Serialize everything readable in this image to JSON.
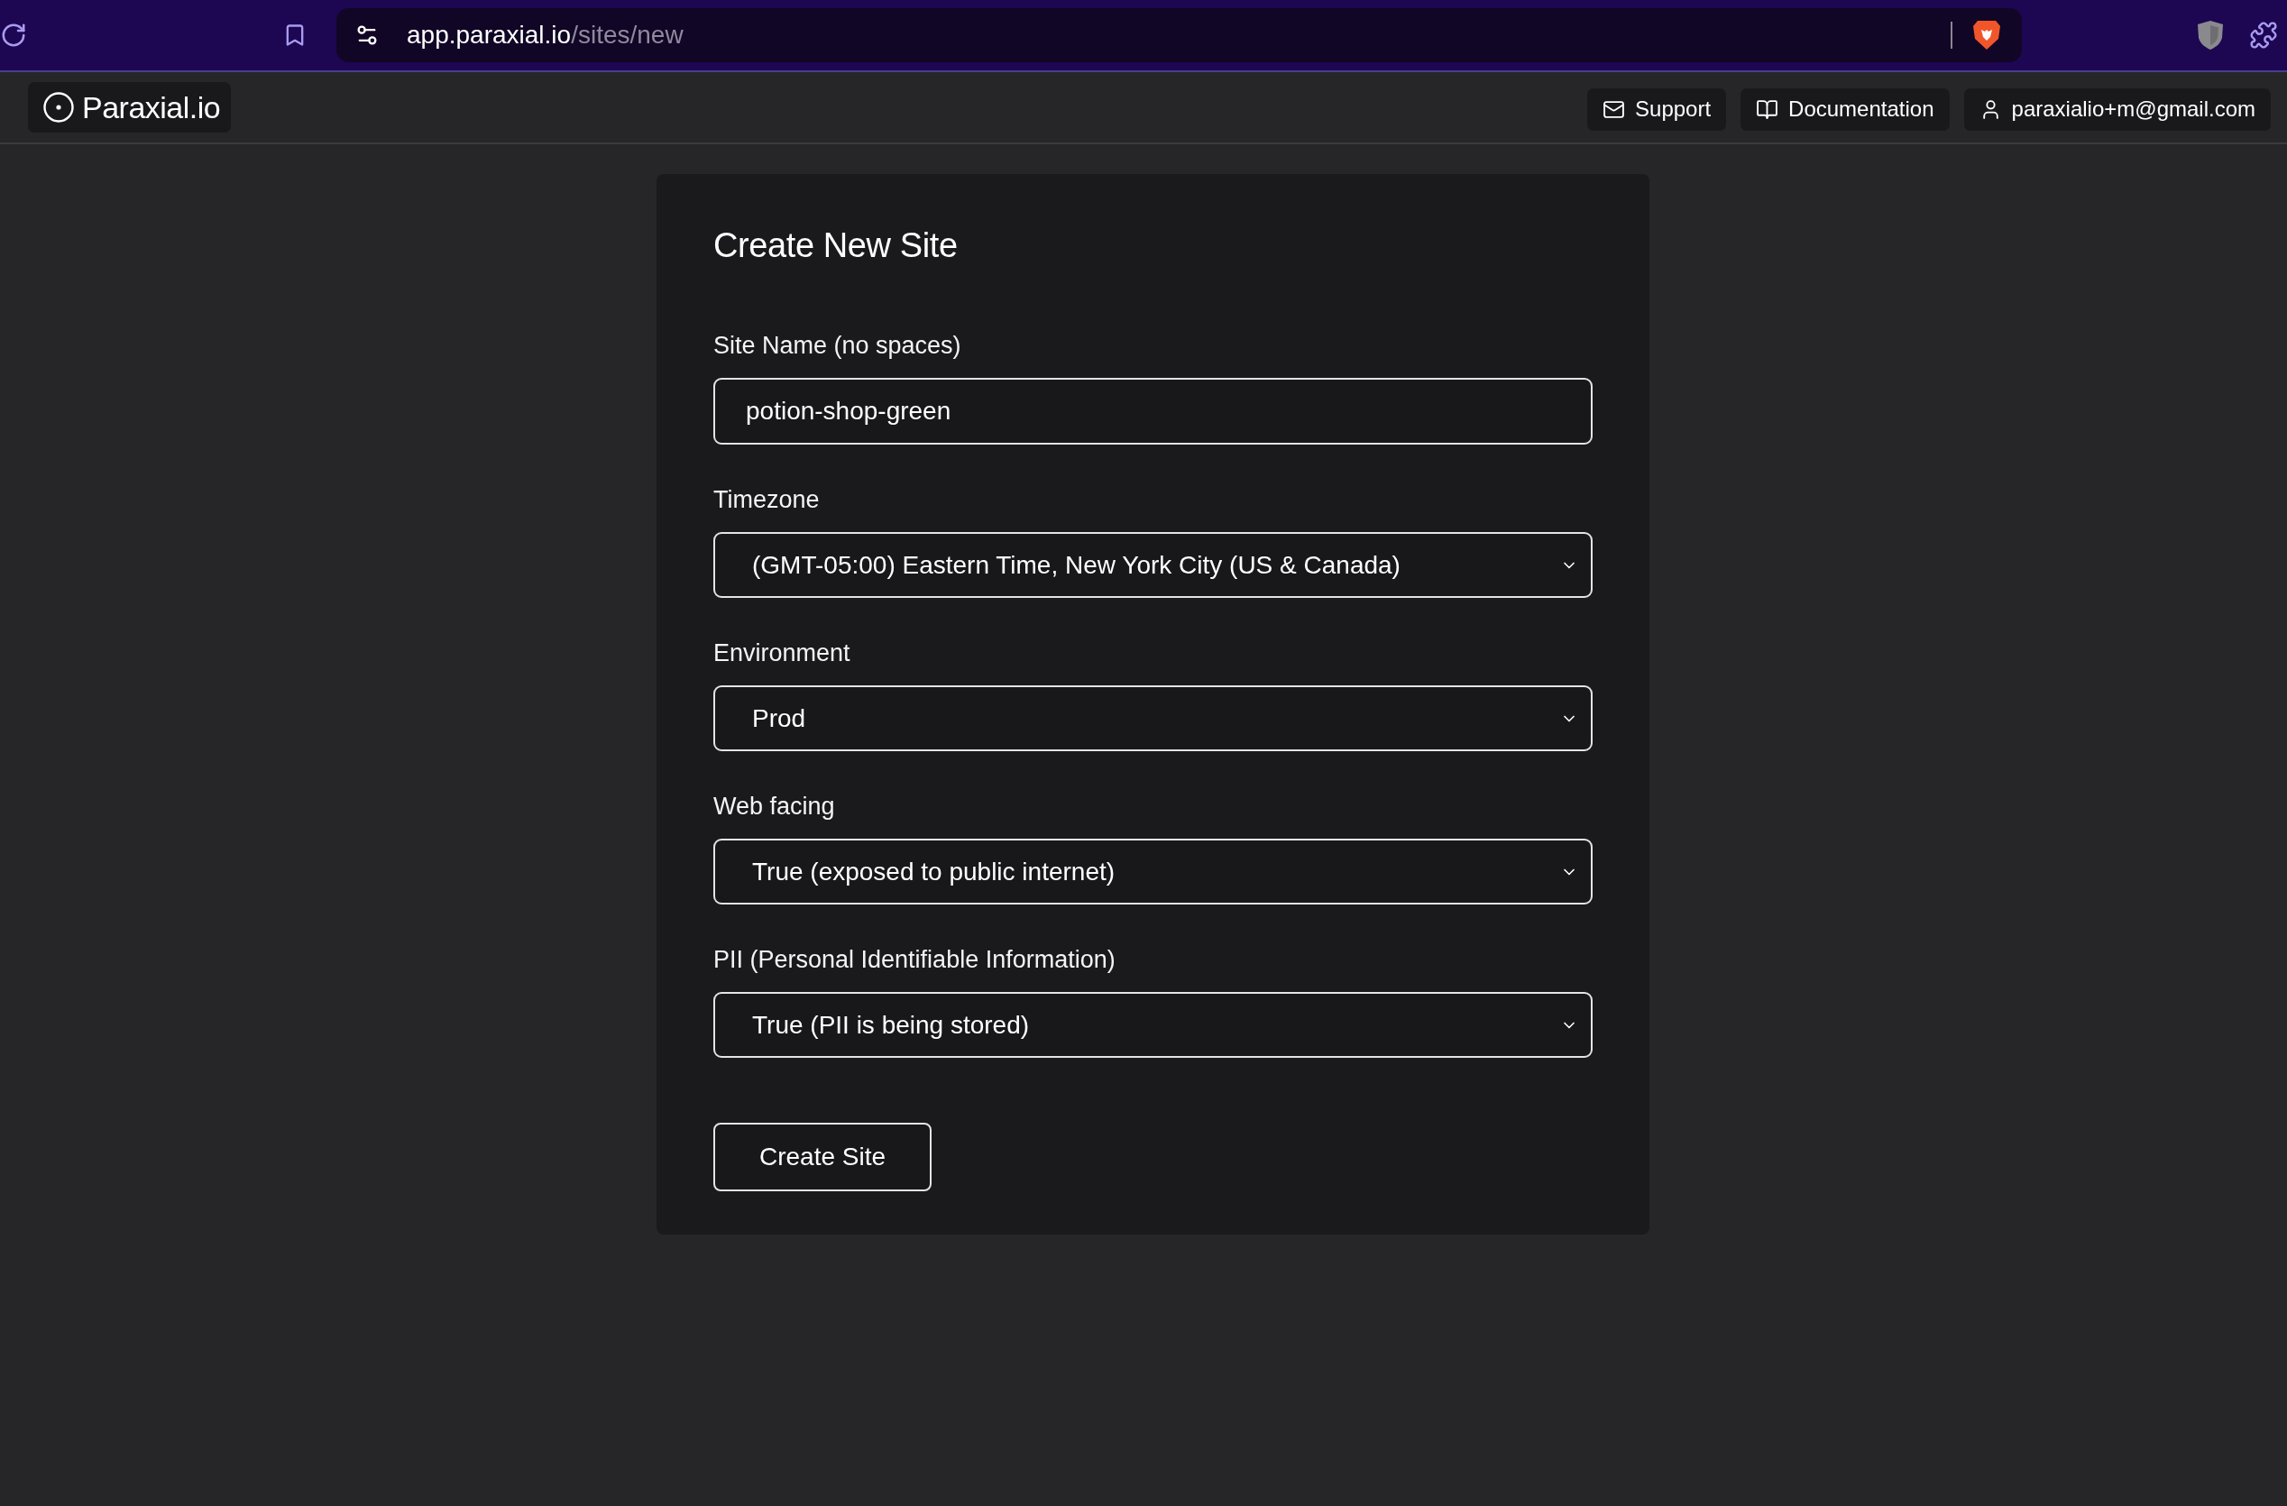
{
  "browser": {
    "url_host": "app.paraxial.io",
    "url_path": "/sites/new"
  },
  "nav": {
    "logo": "Paraxial.io",
    "links": [
      {
        "label": "Support"
      },
      {
        "label": "Documentation"
      },
      {
        "label": "paraxialio+m@gmail.com"
      }
    ]
  },
  "form": {
    "title": "Create New Site",
    "fields": [
      {
        "kind": "text",
        "label": "Site Name (no spaces)",
        "value": "potion-shop-green"
      },
      {
        "kind": "select",
        "label": "Timezone",
        "value": "(GMT-05:00) Eastern Time, New York City (US & Canada)"
      },
      {
        "kind": "select",
        "label": "Environment",
        "value": "Prod"
      },
      {
        "kind": "select",
        "label": "Web facing",
        "value": "True (exposed to public internet)"
      },
      {
        "kind": "select",
        "label": "PII (Personal Identifiable Information)",
        "value": "True (PII is being stored)"
      }
    ],
    "submit": "Create Site"
  }
}
